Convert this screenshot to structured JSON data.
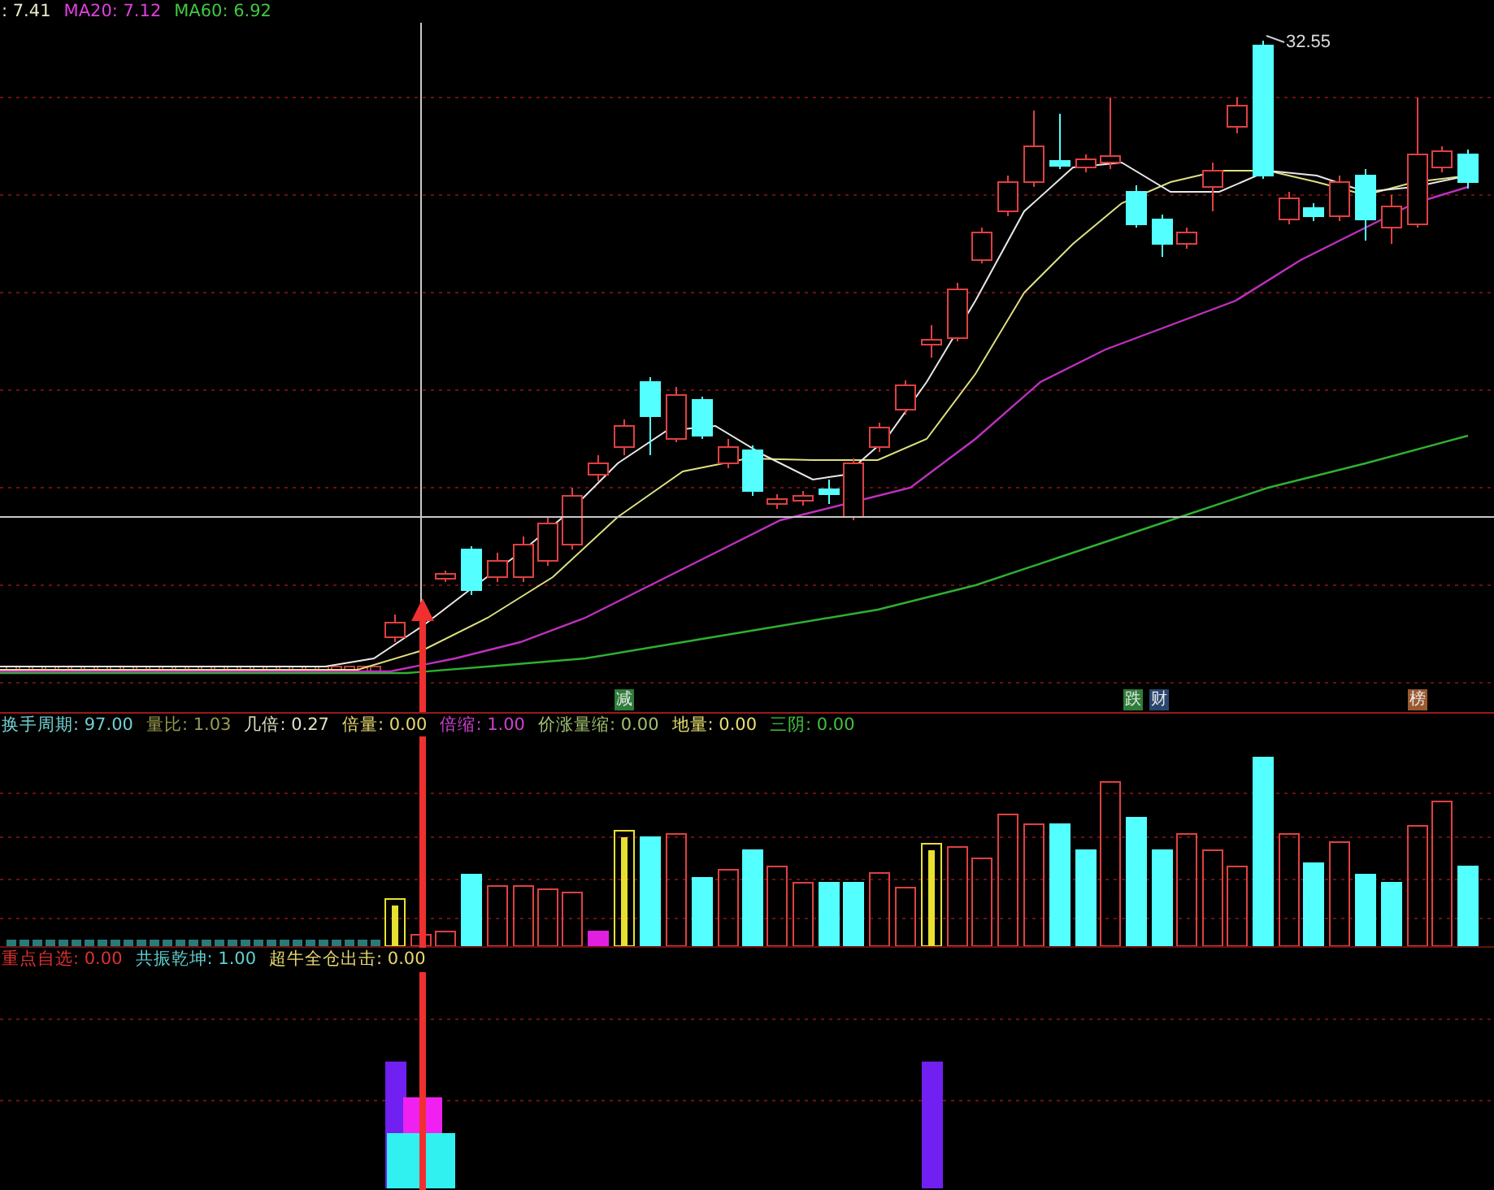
{
  "main_legend": [
    {
      "text": ": 7.41",
      "color": "#e8e8c8"
    },
    {
      "text": "MA20: 7.12",
      "color": "#e040e0"
    },
    {
      "text": "MA60: 6.92",
      "color": "#40c840"
    }
  ],
  "high_label": "32.55",
  "signal_markers": [
    {
      "text": "减",
      "color": "#2e7d3a"
    },
    {
      "text": "跌",
      "color": "#2e7d3a"
    },
    {
      "text": "财",
      "color": "#2a4670"
    },
    {
      "text": "榜",
      "color": "#9a5a30"
    }
  ],
  "volume_legend": [
    {
      "text": "换手周期: 97.00",
      "color": "#70d0d0"
    },
    {
      "text": "量比: 1.03",
      "color": "#9a9a50"
    },
    {
      "text": "几倍: 0.27",
      "color": "#e0e0c0"
    },
    {
      "text": "倍量: 0.00",
      "color": "#e8d870"
    },
    {
      "text": "倍缩: 1.00",
      "color": "#d040d0"
    },
    {
      "text": "价涨量缩: 0.00",
      "color": "#a0c070"
    },
    {
      "text": "地量: 0.00",
      "color": "#e8e070"
    },
    {
      "text": "三阴: 0.00",
      "color": "#40c040"
    }
  ],
  "signal_legend": [
    {
      "text": "重点自选: 0.00",
      "color": "#e03030"
    },
    {
      "text": "共振乾坤: 1.00",
      "color": "#60d0d0"
    },
    {
      "text": "超牛全仓出击: 0.00",
      "color": "#e8d870"
    }
  ]
}
